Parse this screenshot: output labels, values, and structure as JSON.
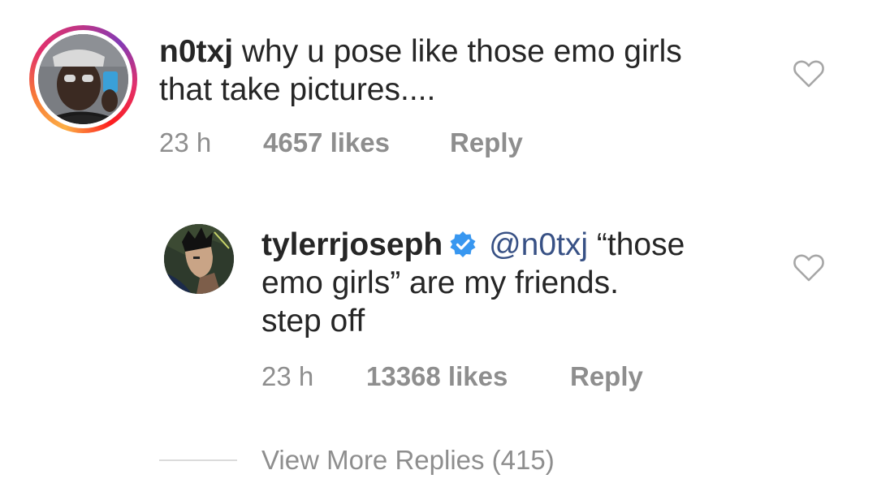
{
  "comments": [
    {
      "username": "n0txj",
      "text_line1": "why u pose like those emo girls",
      "text_line2": "that take pictures....",
      "time": "23 h",
      "likes": "4657 likes",
      "reply_label": "Reply",
      "avatar_icon": "user-avatar-selfie",
      "has_story_ring": true,
      "like_icon": "heart-outline-icon"
    }
  ],
  "replies": [
    {
      "username": "tylerrjoseph",
      "verified": true,
      "mention": "@n0txj",
      "text_line1_rest": "“those",
      "text_line2": "emo girls” are my friends.",
      "text_line3": "step off",
      "time": "23 h",
      "likes": "13368 likes",
      "reply_label": "Reply",
      "avatar_icon": "user-avatar-illustration",
      "like_icon": "heart-outline-icon"
    }
  ],
  "view_more": "View More Replies (415)",
  "colors": {
    "text": "#262626",
    "meta": "#8e8e8e",
    "mention": "#385185",
    "verified": "#3897f0",
    "divider": "#dbdbdb"
  }
}
